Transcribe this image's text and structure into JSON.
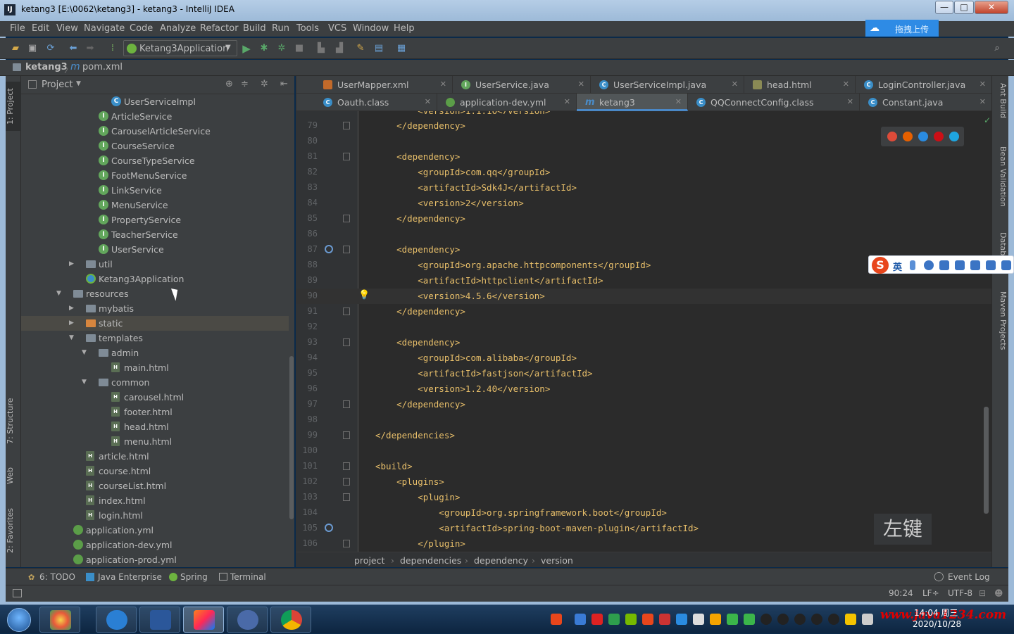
{
  "window": {
    "title": "ketang3 [E:\\0062\\ketang3] - ketang3 - IntelliJ IDEA",
    "minimize": "—",
    "maximize": "□",
    "close": "✕"
  },
  "menu": [
    "File",
    "Edit",
    "View",
    "Navigate",
    "Code",
    "Analyze",
    "Refactor",
    "Build",
    "Run",
    "Tools",
    "VCS",
    "Window",
    "Help"
  ],
  "baidu_upload": "拖拽上传",
  "toolbar": {
    "run_config": "Ketang3Application"
  },
  "navbar": {
    "project": "ketang3",
    "file": "pom.xml"
  },
  "project_panel": {
    "title": "Project",
    "tree": [
      {
        "name": "UserServiceImpl",
        "icon": "class"
      },
      {
        "name": "ArticleService",
        "icon": "interface"
      },
      {
        "name": "CarouselArticleService",
        "icon": "interface"
      },
      {
        "name": "CourseService",
        "icon": "interface"
      },
      {
        "name": "CourseTypeService",
        "icon": "interface"
      },
      {
        "name": "FootMenuService",
        "icon": "interface"
      },
      {
        "name": "LinkService",
        "icon": "interface"
      },
      {
        "name": "MenuService",
        "icon": "interface"
      },
      {
        "name": "PropertyService",
        "icon": "interface"
      },
      {
        "name": "TeacherService",
        "icon": "interface"
      },
      {
        "name": "UserService",
        "icon": "interface"
      },
      {
        "name": "util",
        "icon": "folder"
      },
      {
        "name": "Ketang3Application",
        "icon": "spring-app"
      },
      {
        "name": "resources",
        "icon": "folder"
      },
      {
        "name": "mybatis",
        "icon": "folder"
      },
      {
        "name": "static",
        "icon": "folder"
      },
      {
        "name": "templates",
        "icon": "folder"
      },
      {
        "name": "admin",
        "icon": "folder"
      },
      {
        "name": "main.html",
        "icon": "html"
      },
      {
        "name": "common",
        "icon": "folder"
      },
      {
        "name": "carousel.html",
        "icon": "html"
      },
      {
        "name": "footer.html",
        "icon": "html"
      },
      {
        "name": "head.html",
        "icon": "html"
      },
      {
        "name": "menu.html",
        "icon": "html"
      },
      {
        "name": "article.html",
        "icon": "html"
      },
      {
        "name": "course.html",
        "icon": "html"
      },
      {
        "name": "courseList.html",
        "icon": "html"
      },
      {
        "name": "index.html",
        "icon": "html"
      },
      {
        "name": "login.html",
        "icon": "html"
      },
      {
        "name": "application.yml",
        "icon": "yml"
      },
      {
        "name": "application-dev.yml",
        "icon": "yml"
      },
      {
        "name": "application-prod.yml",
        "icon": "yml"
      }
    ]
  },
  "tabs_row1": [
    {
      "label": "UserMapper.xml",
      "icon": "xml"
    },
    {
      "label": "UserService.java",
      "icon": "interface"
    },
    {
      "label": "UserServiceImpl.java",
      "icon": "class"
    },
    {
      "label": "head.html",
      "icon": "html"
    },
    {
      "label": "LoginController.java",
      "icon": "class"
    }
  ],
  "tabs_row2": [
    {
      "label": "Oauth.class",
      "icon": "class"
    },
    {
      "label": "application-dev.yml",
      "icon": "yml"
    },
    {
      "label": "ketang3",
      "icon": "maven",
      "active": true
    },
    {
      "label": "QQConnectConfig.class",
      "icon": "class"
    },
    {
      "label": "Constant.java",
      "icon": "class"
    }
  ],
  "code_lines": [
    {
      "n": "79",
      "code": "    </dependency>"
    },
    {
      "n": "80",
      "code": ""
    },
    {
      "n": "81",
      "code": "    <dependency>"
    },
    {
      "n": "82",
      "code": "        <groupId>com.qq</groupId>"
    },
    {
      "n": "83",
      "code": "        <artifactId>Sdk4J</artifactId>"
    },
    {
      "n": "84",
      "code": "        <version>2</version>"
    },
    {
      "n": "85",
      "code": "    </dependency>"
    },
    {
      "n": "86",
      "code": ""
    },
    {
      "n": "87",
      "code": "    <dependency>"
    },
    {
      "n": "88",
      "code": "        <groupId>org.apache.httpcomponents</groupId>"
    },
    {
      "n": "89",
      "code": "        <artifactId>httpclient</artifactId>"
    },
    {
      "n": "90",
      "code": "        <version>4.5.6</version>"
    },
    {
      "n": "91",
      "code": "    </dependency>"
    },
    {
      "n": "92",
      "code": ""
    },
    {
      "n": "93",
      "code": "    <dependency>"
    },
    {
      "n": "94",
      "code": "        <groupId>com.alibaba</groupId>"
    },
    {
      "n": "95",
      "code": "        <artifactId>fastjson</artifactId>"
    },
    {
      "n": "96",
      "code": "        <version>1.2.40</version>"
    },
    {
      "n": "97",
      "code": "    </dependency>"
    },
    {
      "n": "98",
      "code": ""
    },
    {
      "n": "99",
      "code": "</dependencies>"
    },
    {
      "n": "100",
      "code": ""
    },
    {
      "n": "101",
      "code": "<build>"
    },
    {
      "n": "102",
      "code": "    <plugins>"
    },
    {
      "n": "103",
      "code": "        <plugin>"
    },
    {
      "n": "104",
      "code": "            <groupId>org.springframework.boot</groupId>"
    },
    {
      "n": "105",
      "code": "            <artifactId>spring-boot-maven-plugin</artifactId>"
    },
    {
      "n": "106",
      "code": "        </plugin>"
    }
  ],
  "editor_breadcrumb": [
    "project",
    "dependencies",
    "dependency",
    "version"
  ],
  "overlay_hint": "左键",
  "right_strip": [
    "Ant Build",
    "Bean Validation",
    "Database",
    "Maven Projects"
  ],
  "left_strip": [
    "1: Project",
    "7: Structure",
    "Web",
    "2: Favorites"
  ],
  "bottom_tools": [
    "6: TODO",
    "Java Enterprise",
    "Spring",
    "Terminal"
  ],
  "event_log": "Event Log",
  "status": {
    "position": "90:24",
    "line_sep": "LF÷",
    "encoding": "UTF-8"
  },
  "ime": {
    "mode": "英"
  },
  "taskbar": {
    "time": "14:04 周三",
    "date": "2020/10/28",
    "watermark": "www.java1234.com"
  }
}
